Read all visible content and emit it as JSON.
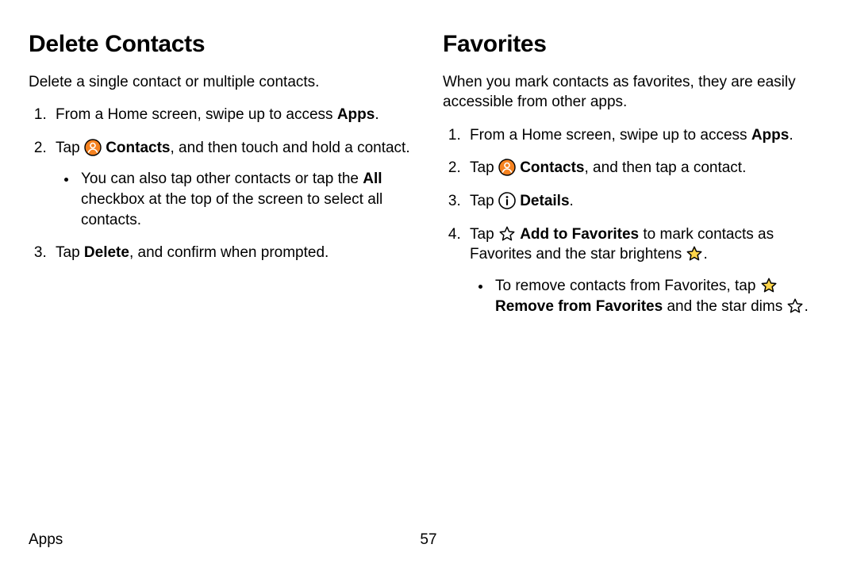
{
  "left": {
    "heading": "Delete Contacts",
    "lead": "Delete a single contact or multiple contacts.",
    "step1_pre": "From a Home screen, swipe up to access ",
    "step1_bold": "Apps",
    "step1_post": ".",
    "step2_pre": "Tap ",
    "step2_bold": "Contacts",
    "step2_post": ", and then touch and hold a contact.",
    "step2_sub_pre": "You can also tap other contacts or tap the ",
    "step2_sub_bold": "All",
    "step2_sub_post": " checkbox at the top of the screen to select all contacts.",
    "step3_pre": "Tap ",
    "step3_bold": "Delete",
    "step3_post": ", and confirm when prompted."
  },
  "right": {
    "heading": "Favorites",
    "lead": "When you mark contacts as favorites, they are easily accessible from other apps.",
    "step1_pre": "From a Home screen, swipe up to access ",
    "step1_bold": "Apps",
    "step1_post": ".",
    "step2_pre": "Tap ",
    "step2_bold": "Contacts",
    "step2_post": ", and then tap a contact.",
    "step3_pre": "Tap ",
    "step3_bold": "Details",
    "step3_post": ".",
    "step4_pre": "Tap ",
    "step4_bold": "Add to Favorites",
    "step4_mid": " to mark contacts as Favorites and the star brightens ",
    "step4_post": ".",
    "step4_sub_pre": "To remove contacts from Favorites, tap ",
    "step4_sub_bold": "Remove from Favorites",
    "step4_sub_mid": " and the star dims ",
    "step4_sub_post": "."
  },
  "footer": {
    "section": "Apps",
    "page": "57"
  }
}
